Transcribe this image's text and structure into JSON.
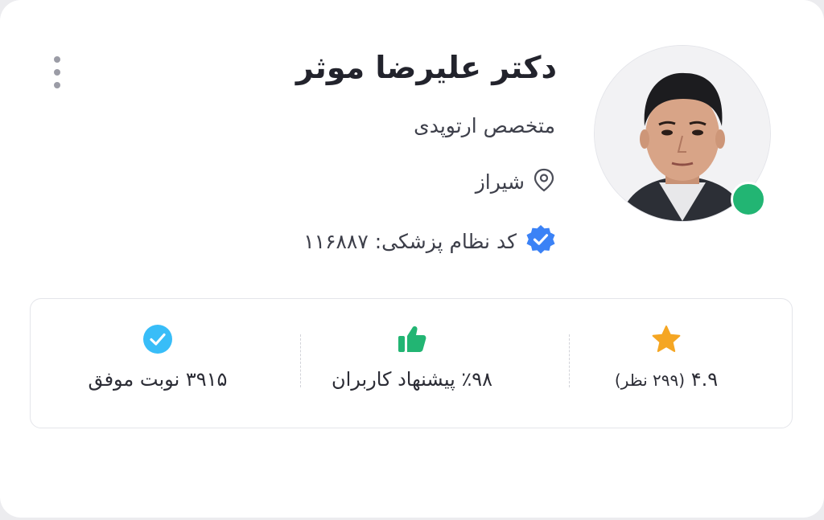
{
  "doctor": {
    "name": "دکتر علیرضا موثر",
    "specialty": "متخصص ارتوپدی",
    "city": "شیراز",
    "medical_code": "کد نظام پزشکی: ۱۱۶۸۸۷",
    "online": true
  },
  "stats": {
    "rating": {
      "score": "۴.۹",
      "reviews": "(۲۹۹ نظر)",
      "icon": "star-icon"
    },
    "recommendation": {
      "label": "٪۹۸ پیشنهاد کاربران",
      "icon": "thumbs-up-icon"
    },
    "appointments": {
      "label": "۳۹۱۵ نوبت موفق",
      "icon": "check-circle-icon"
    }
  },
  "colors": {
    "online": "#22b573",
    "verified": "#3b82f6",
    "star": "#f5a623",
    "thumb": "#22b573",
    "check": "#38bdf8"
  }
}
